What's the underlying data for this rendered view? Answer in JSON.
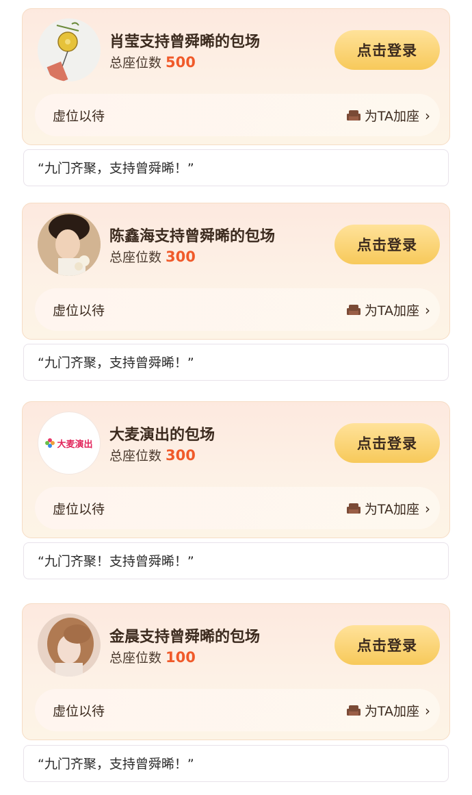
{
  "entries": [
    {
      "title": "肖莹支持曾舜晞的包场",
      "seats_label": "总座位数",
      "seats": "500",
      "login_label": "点击登录",
      "wait_label": "虚位以待",
      "add_seat_label": "为TA加座",
      "comment": "“九门齐聚，支持曾舜晞！”"
    },
    {
      "title": "陈鑫海支持曾舜晞的包场",
      "seats_label": "总座位数",
      "seats": "300",
      "login_label": "点击登录",
      "wait_label": "虚位以待",
      "add_seat_label": "为TA加座",
      "comment": "“九门齐聚，支持曾舜晞！”"
    },
    {
      "title": "大麦演出的包场",
      "avatar_logo_text": "大麦演出",
      "seats_label": "总座位数",
      "seats": "300",
      "login_label": "点击登录",
      "wait_label": "虚位以待",
      "add_seat_label": "为TA加座",
      "comment": "“九门齐聚！支持曾舜晞！”"
    },
    {
      "title": "金晨支持曾舜晞的包场",
      "seats_label": "总座位数",
      "seats": "100",
      "login_label": "点击登录",
      "wait_label": "虚位以待",
      "add_seat_label": "为TA加座",
      "comment": "“九门齐聚，支持曾舜晞！”"
    }
  ],
  "colors": {
    "accent_number": "#f05a2a",
    "button": "#f7c95a",
    "card_bg": "#fde9df"
  }
}
